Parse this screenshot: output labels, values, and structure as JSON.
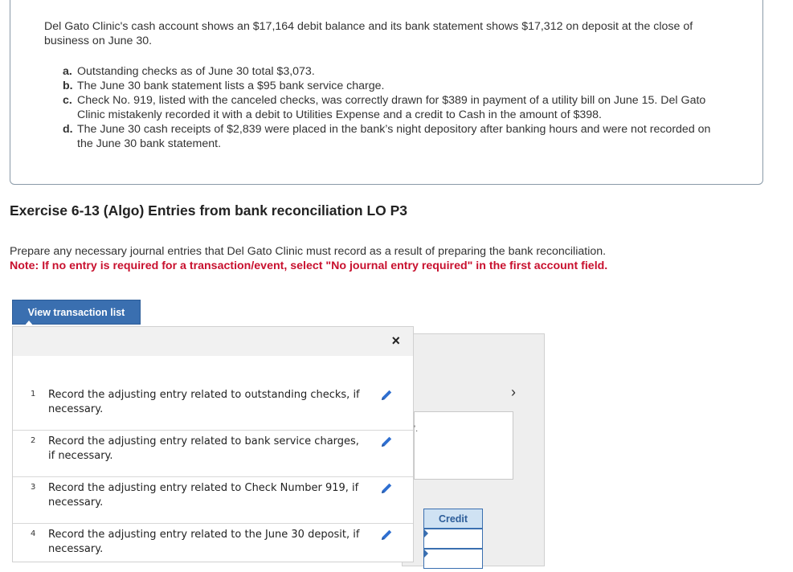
{
  "problem": {
    "intro": "Del Gato Clinic's cash account shows an $17,164 debit balance and its bank statement shows $17,312 on deposit at the close of business on June 30.",
    "items": [
      {
        "letter": "a.",
        "text": "Outstanding checks as of June 30 total $3,073."
      },
      {
        "letter": "b.",
        "text": "The June 30 bank statement lists a $95 bank service charge."
      },
      {
        "letter": "c.",
        "text": "Check No. 919, listed with the canceled checks, was correctly drawn for $389 in payment of a utility bill on June 15. Del Gato Clinic mistakenly recorded it with a debit to Utilities Expense and a credit to Cash in the amount of $398."
      },
      {
        "letter": "d.",
        "text": "The June 30 cash receipts of $2,839 were placed in the bank’s night depository after banking hours and were not recorded on the June 30 bank statement."
      }
    ]
  },
  "exercise": {
    "title": "Exercise 6-13 (Algo) Entries from bank reconciliation LO P3",
    "instruction": "Prepare any necessary journal entries that Del Gato Clinic must record as a result of preparing the bank reconciliation.",
    "note": "Note: If no entry is required for a transaction/event, select \"No journal entry required\" in the first account field."
  },
  "view_button": "View transaction list",
  "popup": {
    "close_label": "×",
    "transactions": [
      {
        "num": "1",
        "text": "Record the adjusting entry related to outstanding checks, if necessary."
      },
      {
        "num": "2",
        "text": "Record the adjusting entry related to bank service charges, if necessary."
      },
      {
        "num": "3",
        "text": "Record the adjusting entry related to Check Number 919, if necessary."
      },
      {
        "num": "4",
        "text": "Record the adjusting entry related to the June 30 deposit, if necessary."
      }
    ]
  },
  "background": {
    "next_arrow": "›",
    "dot_text": "'.",
    "credit_header": "Credit"
  },
  "colors": {
    "accent": "#3a6fb0",
    "note_red": "#c8102e",
    "edit_icon": "#2f6fd0"
  },
  "icons": {
    "edit": "pencil-icon",
    "close": "close-icon",
    "next": "chevron-right-icon"
  }
}
